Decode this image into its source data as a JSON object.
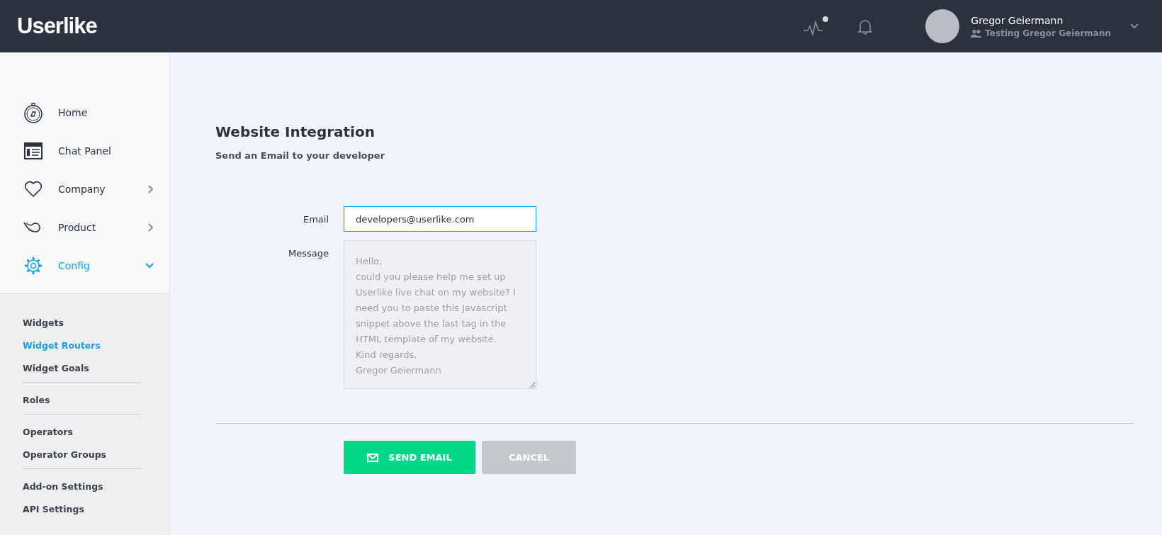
{
  "header": {
    "logo": "Userlike",
    "activity_unread": true,
    "user": {
      "name": "Gregor Geiermann",
      "subtitle": "Testing Gregor Geiermann"
    }
  },
  "sidebar": {
    "items": [
      {
        "label": "Home",
        "kind": "link",
        "selected": false
      },
      {
        "label": "Chat Panel",
        "kind": "link",
        "selected": false
      },
      {
        "label": "Company",
        "kind": "group",
        "expanded": false,
        "selected": false
      },
      {
        "label": "Product",
        "kind": "group",
        "expanded": false,
        "selected": false
      },
      {
        "label": "Config",
        "kind": "group",
        "expanded": true,
        "selected": true
      }
    ],
    "subitems": [
      [
        {
          "label": "Widgets",
          "selected": false
        },
        {
          "label": "Widget Routers",
          "selected": true
        },
        {
          "label": "Widget Goals",
          "selected": false
        }
      ],
      [
        {
          "label": "Roles",
          "selected": false
        }
      ],
      [
        {
          "label": "Operators",
          "selected": false
        },
        {
          "label": "Operator Groups",
          "selected": false
        }
      ],
      [
        {
          "label": "Add-on Settings",
          "selected": false
        },
        {
          "label": "API Settings",
          "selected": false
        }
      ]
    ]
  },
  "main": {
    "title": "Website Integration",
    "subtitle": "Send an Email to your developer",
    "fields": [
      {
        "label": "Email",
        "kind": "input",
        "value": "developers@userlike.com",
        "focused": true
      },
      {
        "label": "Message",
        "kind": "textarea",
        "placeholder": "Hello,\ncould you please help me set up Userlike live chat on my website? I need you to paste this Javascript snippet above the last tag in the HTML template of my website.\nKind regards,\nGregor Geiermann",
        "focused": false
      }
    ],
    "buttons": [
      {
        "label": "SEND EMAIL",
        "kind": "primary"
      },
      {
        "label": "CANCEL",
        "kind": "secondary"
      }
    ]
  }
}
